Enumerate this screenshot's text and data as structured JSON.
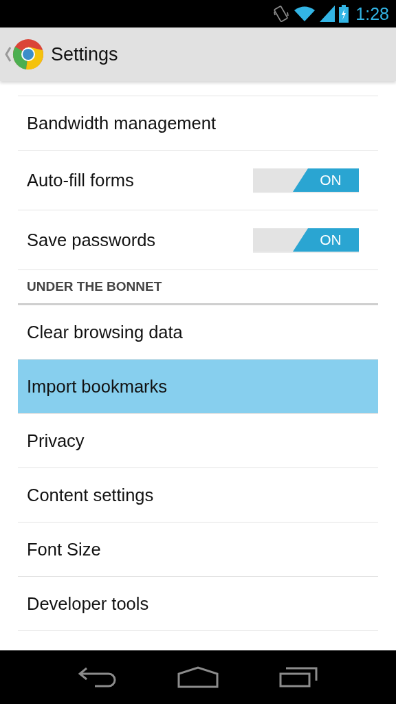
{
  "status_bar": {
    "time": "1:28"
  },
  "action_bar": {
    "title": "Settings"
  },
  "items": [
    {
      "kind": "row",
      "label": "Bandwidth management",
      "selected": false
    },
    {
      "kind": "toggle",
      "label": "Auto-fill forms",
      "selected": false,
      "on": true,
      "switch_text": "ON"
    },
    {
      "kind": "toggle",
      "label": "Save passwords",
      "selected": false,
      "on": true,
      "switch_text": "ON"
    },
    {
      "kind": "section",
      "label": "UNDER THE BONNET"
    },
    {
      "kind": "row",
      "label": "Clear browsing data",
      "selected": false
    },
    {
      "kind": "row",
      "label": "Import bookmarks",
      "selected": true
    },
    {
      "kind": "row",
      "label": "Privacy",
      "selected": false
    },
    {
      "kind": "row",
      "label": "Content settings",
      "selected": false
    },
    {
      "kind": "row",
      "label": "Font Size",
      "selected": false
    },
    {
      "kind": "row",
      "label": "Developer tools",
      "selected": false
    }
  ]
}
